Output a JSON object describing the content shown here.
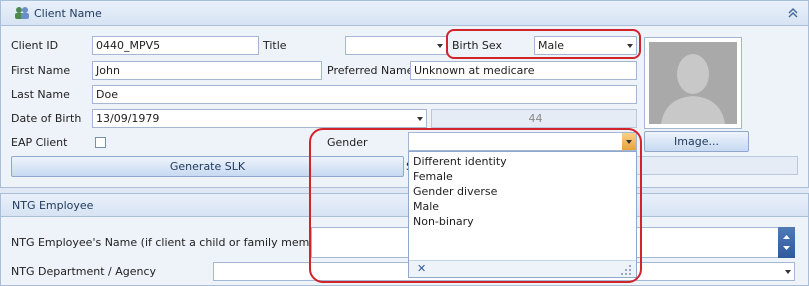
{
  "client_panel": {
    "title": "Client Name",
    "client_id_label": "Client ID",
    "client_id": "0440_MPV5",
    "title_label": "Title",
    "title_value": "",
    "birth_sex_label": "Birth Sex",
    "birth_sex": "Male",
    "first_name_label": "First Name",
    "first_name": "John",
    "preferred_name_label": "Preferred Name",
    "preferred_name": "Unknown at medicare",
    "last_name_label": "Last Name",
    "last_name": "Doe",
    "dob_label": "Date of Birth",
    "dob": "13/09/1979",
    "age": "44",
    "eap_label": "EAP Client",
    "gender_label": "Gender",
    "gender_value": "",
    "image_button": "Image...",
    "generate_slk_button": "Generate SLK",
    "slk_partial_label": "S"
  },
  "gender_dropdown": {
    "options": [
      "Different identity",
      "Female",
      "Gender diverse",
      "Male",
      "Non-binary"
    ],
    "clear_glyph": "✕"
  },
  "ntg_panel": {
    "title": "NTG Employee",
    "employee_name_label": "NTG Employee's Name (if client a child or family member)",
    "department_label": "NTG Department / Agency",
    "department_value": ""
  },
  "colors": {
    "highlight": "#d1242b",
    "panel_bg": "#eef3fa",
    "accent": "#e8a33a"
  }
}
